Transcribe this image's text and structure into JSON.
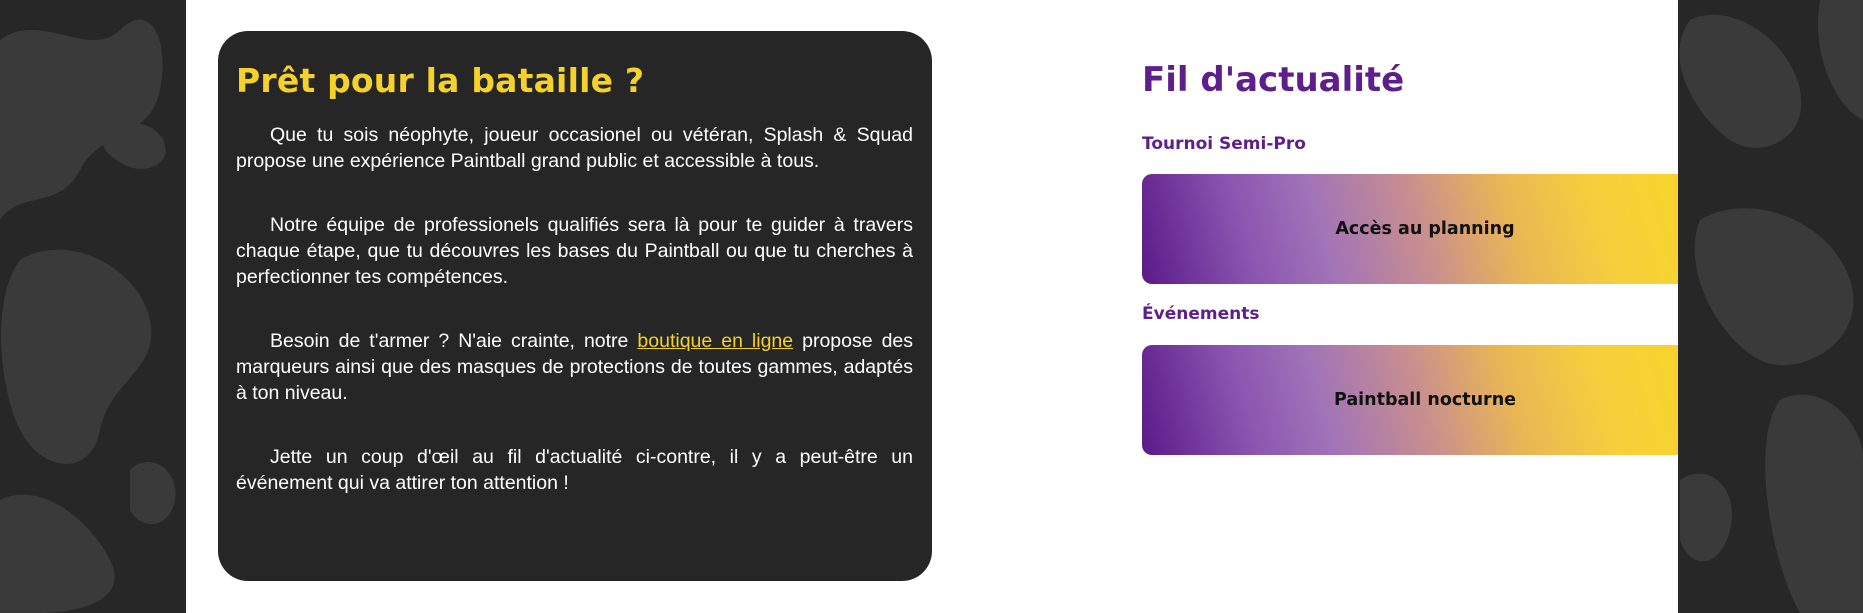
{
  "intro": {
    "title": "Prêt pour la bataille ?",
    "paragraph1": "Que tu sois néophyte, joueur occasionel ou vétéran, Splash & Squad propose une expérience Paintball grand public et accessible à tous.",
    "paragraph2": "Notre équipe de professionels qualifiés sera là pour te guider à travers chaque étape, que tu découvres les bases du Paintball ou que tu cherches à perfectionner tes compétences.",
    "paragraph3_before": "Besoin de t'armer ? N'aie crainte, notre ",
    "paragraph3_link": "boutique en ligne",
    "paragraph3_after": " propose des marqueurs ainsi que des masques de protections de toutes gammes, adaptés à ton niveau.",
    "paragraph4": "Jette un coup d'œil au fil d'actualité ci-contre, il y a peut-être un événement qui va attirer ton attention !"
  },
  "feed": {
    "title": "Fil d'actualité",
    "sections": [
      {
        "heading": "Tournoi Semi-Pro",
        "button_label": "Accès au planning"
      },
      {
        "heading": "Événements",
        "button_label": "Paintball nocturne"
      }
    ]
  },
  "colors": {
    "accent_yellow": "#f5d12b",
    "accent_purple": "#5e1f8a",
    "card_background": "#262626",
    "page_background": "#252525"
  }
}
